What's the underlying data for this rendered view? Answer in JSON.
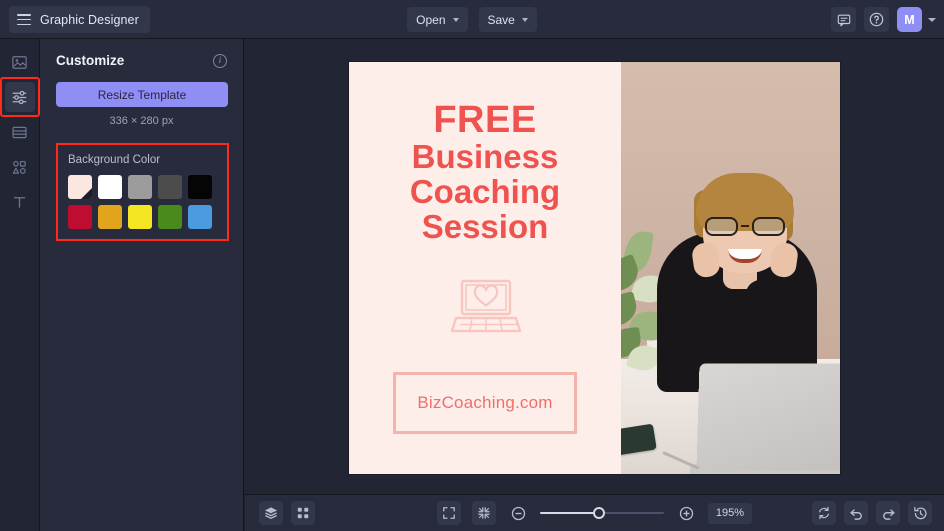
{
  "header": {
    "app_title": "Graphic Designer",
    "menu_icon": "hamburger-icon",
    "open_label": "Open",
    "save_label": "Save",
    "comment_icon": "comment-icon",
    "help_icon": "help-icon",
    "avatar_initial": "M"
  },
  "rail": {
    "items": [
      {
        "name": "images",
        "icon": "image-icon"
      },
      {
        "name": "customize",
        "icon": "sliders-icon",
        "active": true,
        "highlighted": true
      },
      {
        "name": "templates",
        "icon": "template-icon"
      },
      {
        "name": "elements",
        "icon": "shapes-icon"
      },
      {
        "name": "text",
        "icon": "text-icon"
      }
    ]
  },
  "panel": {
    "title": "Customize",
    "info_icon": "info-icon",
    "resize_label": "Resize Template",
    "dimensions": "336 × 280 px",
    "background": {
      "label": "Background Color",
      "highlighted": true,
      "swatches": [
        {
          "name": "blush",
          "hex": "#fbe7e2",
          "selected": true
        },
        {
          "name": "white",
          "hex": "#ffffff",
          "selected": false
        },
        {
          "name": "gray",
          "hex": "#9b9b9b",
          "selected": false
        },
        {
          "name": "dark-gray",
          "hex": "#4c4c4c",
          "selected": false
        },
        {
          "name": "black",
          "hex": "#050505",
          "selected": false
        },
        {
          "name": "crimson",
          "hex": "#bf0d32",
          "selected": false
        },
        {
          "name": "orange",
          "hex": "#e2a41b",
          "selected": false
        },
        {
          "name": "yellow",
          "hex": "#f5e523",
          "selected": false
        },
        {
          "name": "green",
          "hex": "#4a8a1c",
          "selected": false
        },
        {
          "name": "blue",
          "hex": "#4a9be0",
          "selected": false
        }
      ]
    }
  },
  "canvas": {
    "background_hex": "#fdeeea",
    "accent_hex": "#ef5350",
    "headline": {
      "line1": "FREE",
      "line2": "Business",
      "line3": "Coaching",
      "line4": "Session"
    },
    "laptop_icon": "laptop-heart-icon",
    "url_text": "BizCoaching.com",
    "photo_alt": "smiling-woman-at-desk-with-laptop"
  },
  "bottombar": {
    "layers_icon": "layers-icon",
    "grid_icon": "grid-icon",
    "fit_icon": "fit-to-screen-icon",
    "shrink_icon": "zoom-fit-icon",
    "zoom_out_icon": "zoom-out-icon",
    "zoom_in_icon": "zoom-in-icon",
    "zoom_level": "195%",
    "reset_icon": "reset-icon",
    "undo_icon": "undo-icon",
    "redo_icon": "redo-icon",
    "history_icon": "history-icon"
  }
}
